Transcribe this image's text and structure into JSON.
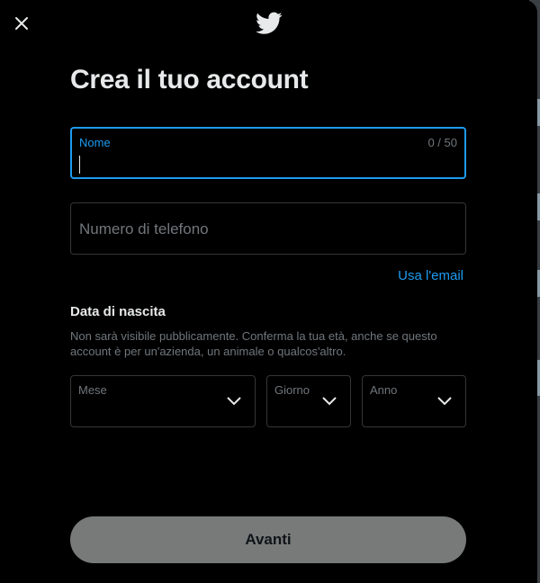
{
  "header": {
    "close_icon": "close-icon",
    "logo_icon": "twitter-bird-icon"
  },
  "title": "Crea il tuo account",
  "name_field": {
    "label": "Nome",
    "counter": "0 / 50",
    "value": ""
  },
  "phone_field": {
    "placeholder": "Numero di telefono"
  },
  "use_email_link": "Usa l'email",
  "dob": {
    "title": "Data di nascita",
    "description": "Non sarà visibile pubblicamente. Conferma la tua età, anche se questo account è per un'azienda, un animale o qualcos'altro.",
    "month_label": "Mese",
    "day_label": "Giorno",
    "year_label": "Anno"
  },
  "next_button": "Avanti",
  "colors": {
    "accent": "#1d9bf0",
    "background": "#000000",
    "disabled_button": "#787a7a"
  }
}
